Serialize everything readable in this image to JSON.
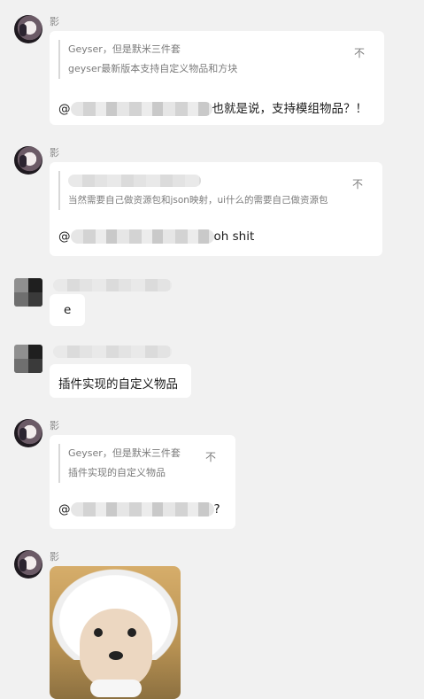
{
  "messages": [
    {
      "sender": "影",
      "quote": {
        "title": "Geyser，但是默米三件套",
        "text": "geyser最新版本支持自定义物品和方块",
        "close": "不"
      },
      "at": "@",
      "text": "也就是说，支持模组物品？！"
    },
    {
      "sender": "影",
      "quote": {
        "title": "",
        "text": "当然需要自己做资源包和json映射，ui什么的需要自己做资源包",
        "close": "不"
      },
      "at": "@",
      "text": "oh shit"
    },
    {
      "sender": "",
      "text": "e"
    },
    {
      "sender": "",
      "text": "插件实现的自定义物品"
    },
    {
      "sender": "影",
      "quote": {
        "title": "Geyser，但是默米三件套",
        "text": "插件实现的自定义物品",
        "close": "不"
      },
      "at": "@",
      "text": "?"
    },
    {
      "sender": "影",
      "sticker": "sheep-sticker"
    }
  ]
}
